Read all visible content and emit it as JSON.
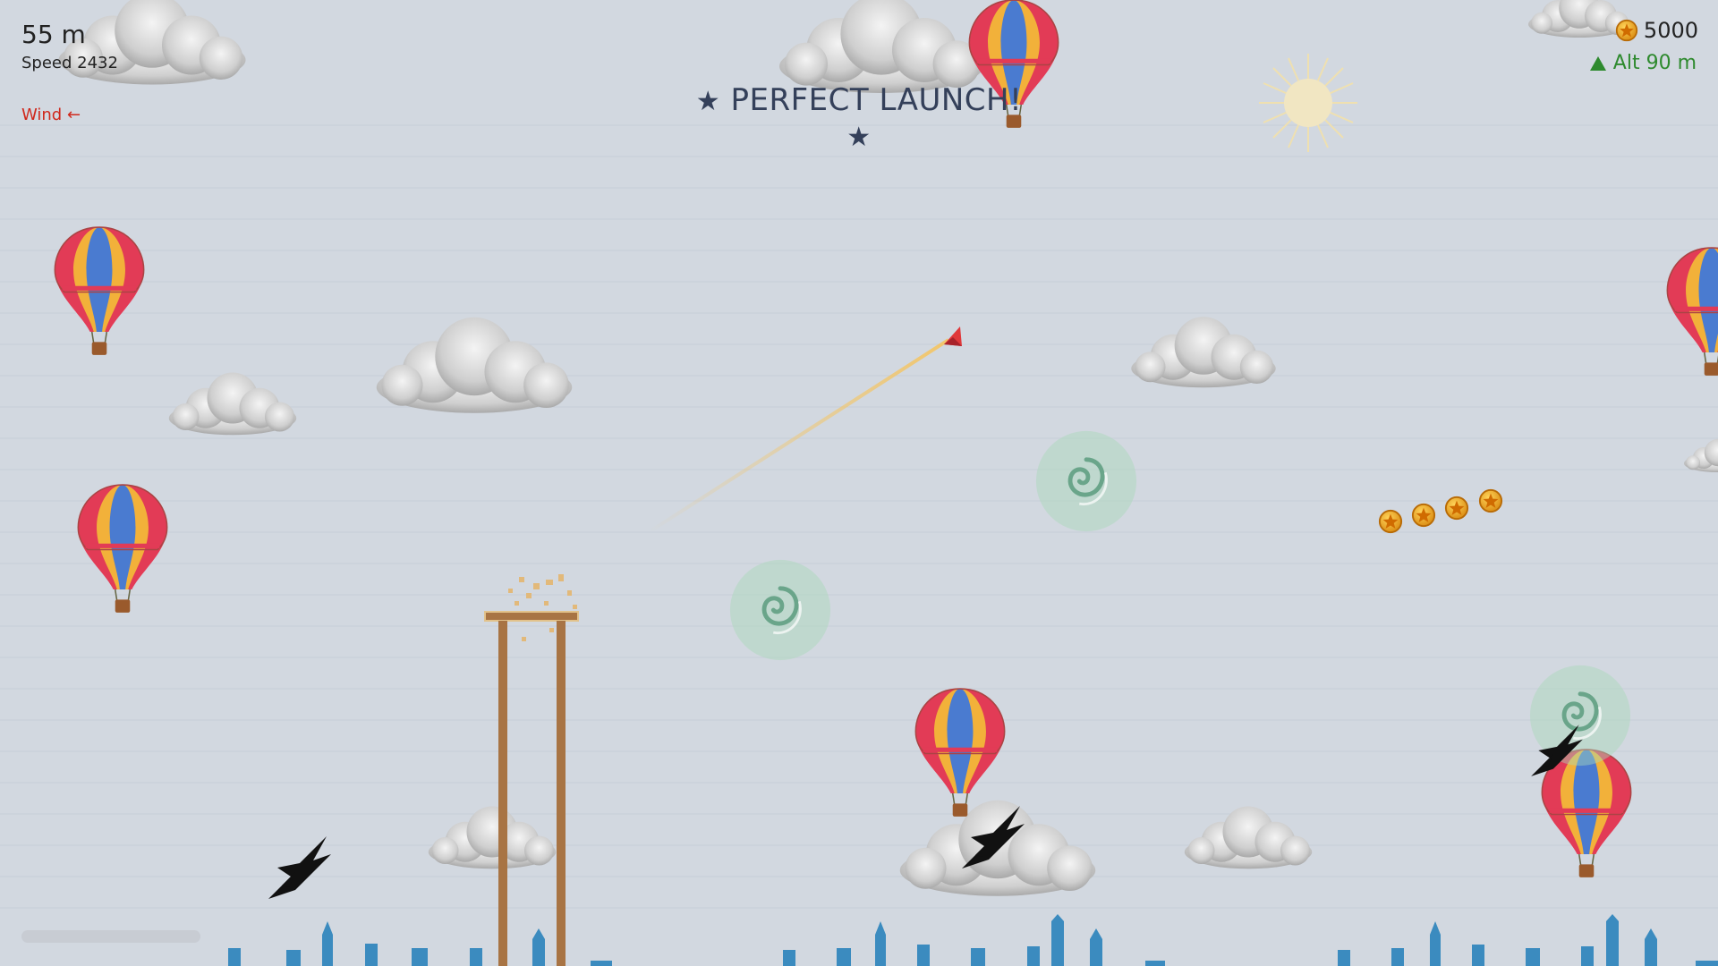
{
  "hud": {
    "distance": "55 m",
    "speed": "Speed 2432",
    "wind": "Wind ←",
    "coins": "5000",
    "altitude": "Alt 90 m"
  },
  "banner": {
    "text": "PERFECT LAUNCH!"
  },
  "colors": {
    "sky": "#d2d8e0",
    "hud_text": "#222222",
    "wind": "#d0281c",
    "altitude": "#2e8a2e",
    "banner": "#34405a",
    "trail": "#f2c66b",
    "plane": "#e0383a",
    "tower": "#a87444",
    "skyline": "#3b8bbf",
    "coin": "#f0a020"
  },
  "icons": {
    "coin": "coin-icon",
    "altitude": "up-triangle-icon",
    "plane": "paper-plane-icon",
    "boost": "swirl-boost-icon",
    "bird": "bird-icon",
    "balloon": "hot-air-balloon-icon",
    "sun": "sun-icon",
    "cloud": "cloud-icon"
  },
  "progress": 0.0
}
